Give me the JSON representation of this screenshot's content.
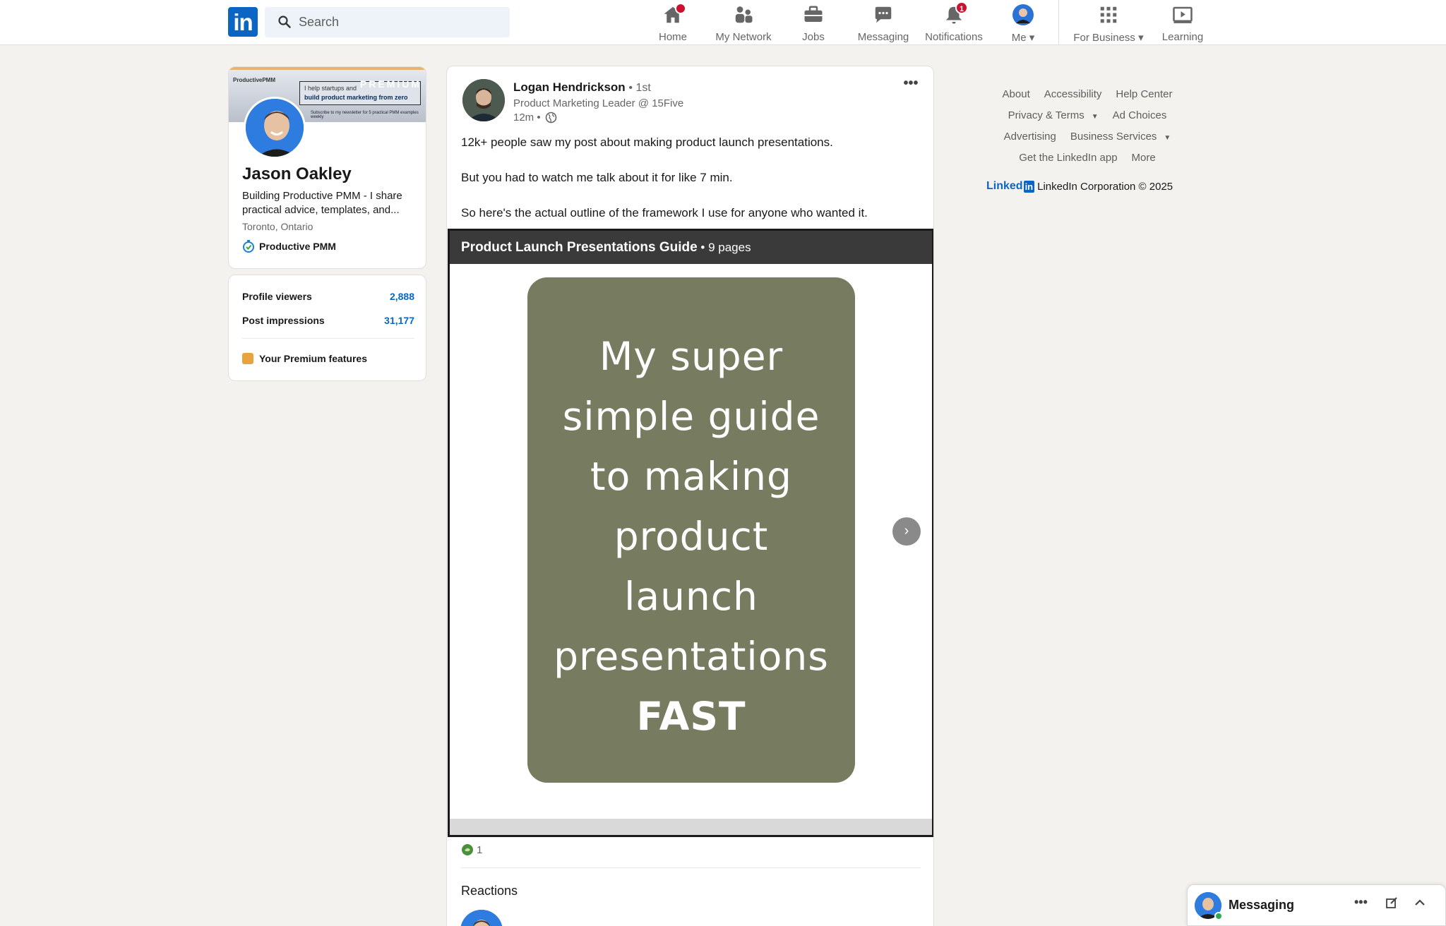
{
  "nav": {
    "logo_text": "in",
    "search_placeholder": "Search",
    "items": [
      {
        "label": "Home",
        "icon": "home-icon"
      },
      {
        "label": "My Network",
        "icon": "network-icon"
      },
      {
        "label": "Jobs",
        "icon": "briefcase-icon"
      },
      {
        "label": "Messaging",
        "icon": "chat-icon"
      },
      {
        "label": "Notifications",
        "icon": "bell-icon",
        "badge": "1"
      },
      {
        "label": "Me",
        "icon": "avatar"
      },
      {
        "label": "For Business",
        "icon": "grid-icon"
      },
      {
        "label": "Learning",
        "icon": "learning-icon"
      }
    ]
  },
  "profile": {
    "banner_brand": "ProductivePMM",
    "banner_premium": "PREMIUM",
    "banner_line1": "I help startups and",
    "banner_line2": "build product marketing from zero",
    "banner_sub": "Subscribe to my newsletter for 5 practical PMM examples weekly",
    "name": "Jason Oakley",
    "headline": "Building Productive PMM - I share practical advice, templates, and...",
    "location": "Toronto, Ontario",
    "org": "Productive PMM"
  },
  "stats": {
    "viewers_label": "Profile viewers",
    "viewers_value": "2,888",
    "impressions_label": "Post impressions",
    "impressions_value": "31,177",
    "premium_label": "Your Premium features"
  },
  "post": {
    "author": "Logan Hendrickson",
    "degree": "• 1st",
    "author_title": "Product Marketing Leader @ 15Five",
    "time": "12m •",
    "text1": "12k+ people saw my post about making product launch presentations.",
    "text2": "But you had to watch me talk about it for like 7 min.",
    "text3": "So here's the actual outline of the framework I use for anyone who wanted it.",
    "doc_title": "Product Launch Presentations Guide",
    "doc_pages": " • 9 pages",
    "slide_lines": [
      "My super",
      "simple guide",
      "to making",
      "product",
      "launch",
      "presentations",
      "FAST"
    ],
    "reaction_count": "1",
    "reactions_heading": "Reactions"
  },
  "footer": {
    "about": "About",
    "accessibility": "Accessibility",
    "help": "Help Center",
    "privacy": "Privacy & Terms",
    "ad_choices": "Ad Choices",
    "advertising": "Advertising",
    "business": "Business Services",
    "get_app": "Get the LinkedIn app",
    "more": "More",
    "brand": "Linked",
    "brand_in": "in",
    "copyright": "LinkedIn Corporation © 2025"
  },
  "messaging": {
    "title": "Messaging"
  },
  "colors": {
    "brand": "#0a66c2",
    "slide_bg": "#777b5f",
    "badge": "#cb112d"
  }
}
